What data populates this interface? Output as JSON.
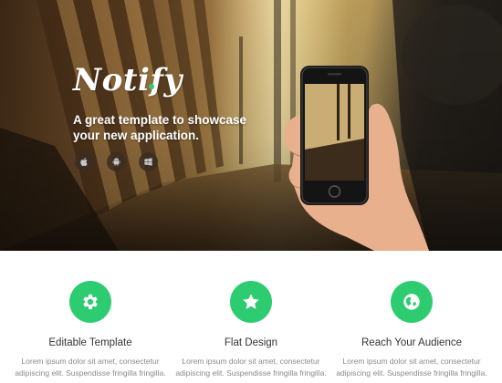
{
  "hero": {
    "logo_text": "Notify",
    "tagline_line1": "A great template to showcase",
    "tagline_line2": "your new application.",
    "platforms": [
      {
        "icon": "apple-icon"
      },
      {
        "icon": "android-icon"
      },
      {
        "icon": "windows-icon"
      }
    ]
  },
  "features": [
    {
      "icon": "gear-icon",
      "title": "Editable Template",
      "text_line1": "Lorem ipsum dolor sit amet, consectetur",
      "text_line2": "adipiscing elit. Suspendisse fringilla fringilla."
    },
    {
      "icon": "star-icon",
      "title": "Flat Design",
      "text_line1": "Lorem ipsum dolor sit amet, consectetur",
      "text_line2": "adipiscing elit. Suspendisse fringilla fringilla."
    },
    {
      "icon": "globe-icon",
      "title": "Reach Your Audience",
      "text_line1": "Lorem ipsum dolor sit amet, consectetur",
      "text_line2": "adipiscing elit. Suspendisse fringilla fringilla."
    }
  ],
  "colors": {
    "accent": "#2ecc71",
    "heading": "#333333",
    "body_text": "#8a8a8a"
  }
}
